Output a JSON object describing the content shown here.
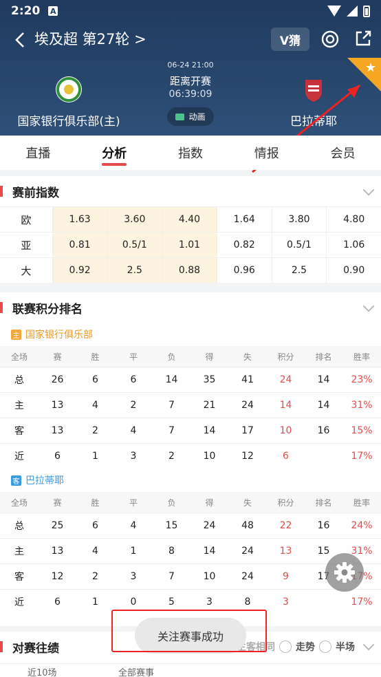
{
  "status_bar": {
    "time": "2:20",
    "badge": "A"
  },
  "nav": {
    "title": "埃及超 第27轮 >",
    "vguess": "V猜"
  },
  "match": {
    "datetime": "06-24 21:00",
    "countdown_label": "距离开赛",
    "countdown": "06:39:09",
    "animation_label": "动画",
    "home_name": "国家银行俱乐部(主)",
    "away_name": "巴拉蒂耶",
    "home_color": "#2f8f3a",
    "away_color": "#c8323a"
  },
  "tabs": [
    {
      "label": "直播"
    },
    {
      "label": "分析"
    },
    {
      "label": "指数"
    },
    {
      "label": "情报"
    },
    {
      "label": "会员"
    }
  ],
  "odds": {
    "title": "赛前指数",
    "rows": [
      {
        "label": "欧",
        "values": [
          "1.63",
          "3.60",
          "4.40",
          "1.64",
          "3.80",
          "4.80"
        ]
      },
      {
        "label": "亚",
        "values": [
          "0.81",
          "0.5/1",
          "1.01",
          "0.82",
          "0.5/1",
          "1.06"
        ]
      },
      {
        "label": "大",
        "values": [
          "0.92",
          "2.5",
          "0.88",
          "0.96",
          "2.5",
          "0.90"
        ]
      }
    ]
  },
  "standings": {
    "title": "联赛积分排名",
    "columns": [
      "全场",
      "赛",
      "胜",
      "平",
      "负",
      "得",
      "失",
      "积分",
      "排名",
      "胜率"
    ],
    "home": {
      "badge": "主",
      "name": "国家银行俱乐部",
      "rows": [
        [
          "总",
          "26",
          "6",
          "6",
          "14",
          "35",
          "41",
          "24",
          "14",
          "23%"
        ],
        [
          "主",
          "13",
          "4",
          "2",
          "7",
          "21",
          "24",
          "14",
          "14",
          "31%"
        ],
        [
          "客",
          "13",
          "2",
          "4",
          "7",
          "14",
          "17",
          "10",
          "16",
          "15%"
        ],
        [
          "近",
          "6",
          "1",
          "3",
          "2",
          "10",
          "12",
          "6",
          "",
          "17%"
        ]
      ]
    },
    "away": {
      "badge": "客",
      "name": "巴拉蒂耶",
      "rows": [
        [
          "总",
          "25",
          "6",
          "4",
          "15",
          "24",
          "48",
          "22",
          "16",
          "24%"
        ],
        [
          "主",
          "13",
          "4",
          "1",
          "8",
          "14",
          "24",
          "13",
          "15",
          "31%"
        ],
        [
          "客",
          "12",
          "2",
          "3",
          "7",
          "10",
          "24",
          "9",
          "17",
          "17%"
        ],
        [
          "近",
          "6",
          "1",
          "0",
          "5",
          "3",
          "8",
          "3",
          "",
          "17%"
        ]
      ]
    }
  },
  "h2h": {
    "title": "对赛往绩",
    "option_same": "主客相同",
    "option_trend": "走势",
    "option_half": "半场"
  },
  "bottom": {
    "left": "近10场",
    "mid": "全部赛事"
  },
  "toast": "关注赛事成功",
  "colors": {
    "accent": "#e54b4b",
    "header": "#1e3a5e",
    "star": "#f5a623"
  }
}
